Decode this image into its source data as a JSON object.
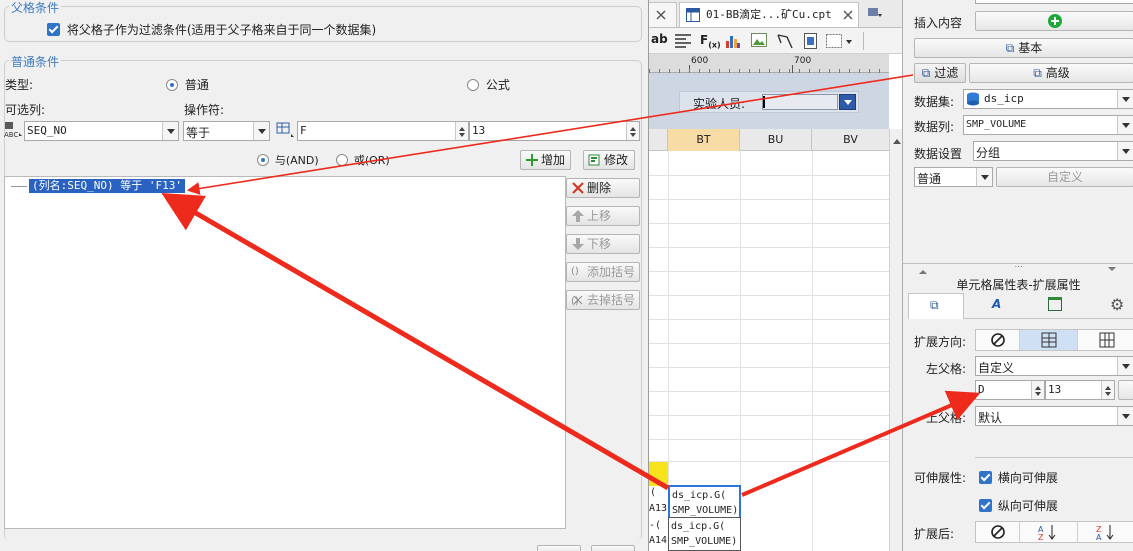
{
  "dialog": {
    "parent_condition": {
      "legend": "父格条件",
      "checkbox_label": "将父格子作为过滤条件(适用于父子格来自于同一个数据集)"
    },
    "normal_condition": {
      "legend": "普通条件",
      "type_label": "类型:",
      "type_options": [
        "普通",
        "公式"
      ],
      "available_column_label": "可选列:",
      "operator_label": "操作符:",
      "column_value": "SEQ_NO",
      "operator_value": "等于",
      "target_col": "F",
      "target_row": "13",
      "logic_options": [
        "与(AND)",
        "或(OR)"
      ],
      "add_button": "增加",
      "modify_button": "修改",
      "condition_item": "(列名:SEQ_NO) 等于 'F13'",
      "side_buttons": [
        "删除",
        "上移",
        "下移",
        "添加括号",
        "去掉括号"
      ]
    }
  },
  "sheet": {
    "tab_label": "01-BB滴定...矿Cu.cpt",
    "ruler_marks": [
      "600",
      "700"
    ],
    "param_label": "实验人员:",
    "columns": [
      "BT",
      "BU",
      "BV"
    ],
    "cell_lines": [
      "ds_icp.G(",
      "SMP_VOLUME)",
      "ds_icp.G(",
      "SMP_VOLUME)"
    ],
    "row_stub": [
      "(",
      "A13",
      "-(",
      "A14"
    ]
  },
  "props": {
    "insert_label": "插入内容",
    "basic_button": "基本",
    "filter_button": "过滤",
    "advanced_button": "高级",
    "dataset_label": "数据集:",
    "dataset_value": "ds_icp",
    "datacol_label": "数据列:",
    "datacol_value": "SMP_VOLUME",
    "dataset_setting_label": "数据设置",
    "dataset_setting_value": "分组",
    "mode_value": "普通",
    "custom_button": "自定义",
    "section_title": "单元格属性表-扩展属性",
    "expand_dir_label": "扩展方向:",
    "left_parent_label": "左父格:",
    "left_parent_value": "自定义",
    "left_parent_col": "D",
    "left_parent_row": "13",
    "top_parent_label": "上父格:",
    "top_parent_value": "默认",
    "stretch_label": "可伸展性:",
    "stretch_h": "横向可伸展",
    "stretch_v": "纵向可伸展",
    "after_expand_label": "扩展后:"
  }
}
